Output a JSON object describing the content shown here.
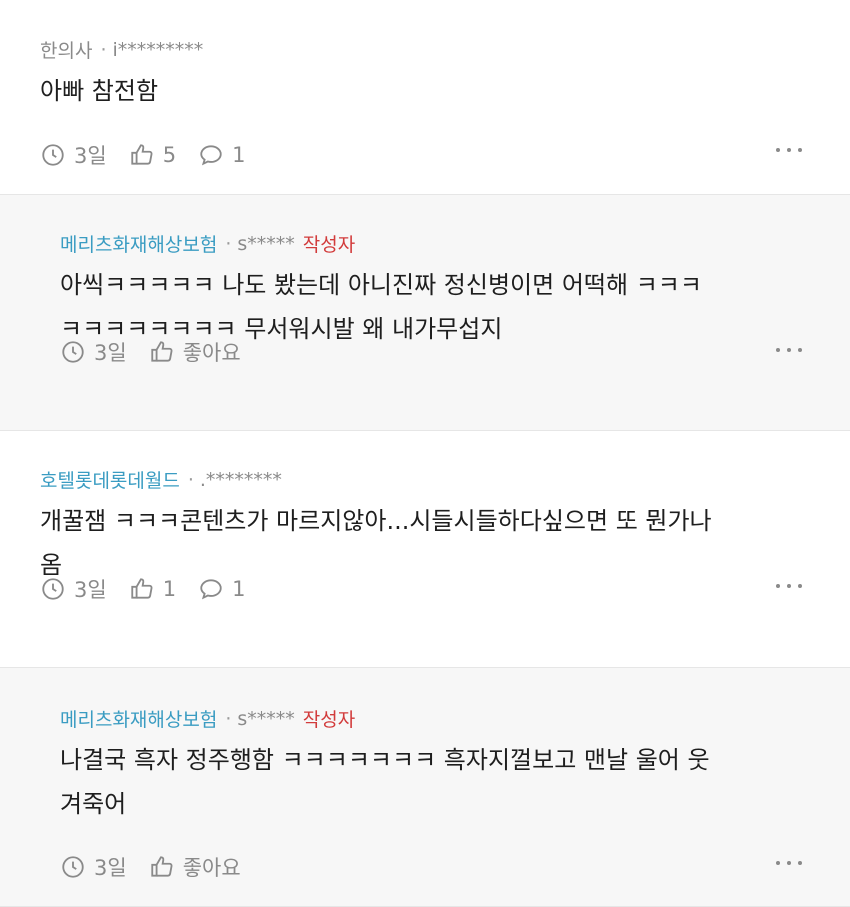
{
  "comments": [
    {
      "nickname": "한의사",
      "user": "i*********",
      "text_lines": [
        "아빠 참전함"
      ],
      "time": "3일",
      "likes": "5",
      "replies": "1"
    },
    {
      "nickname": "메리츠화재해상보험",
      "user": "s*****",
      "author_tag": "작성자",
      "text_lines": [
        "아씩ㅋㅋㅋㅋㅋ 나도 봤는데 아니진짜 정신병이면 어떡해 ㅋㅋㅋ",
        "ㅋㅋㅋㅋㅋㅋㅋㅋ 무서워시발 왜 내가무섭지"
      ],
      "time": "3일",
      "likes": "좋아요"
    },
    {
      "nickname": "호텔롯데롯데월드",
      "user": ".********",
      "text_lines": [
        "개꿀잼 ㅋㅋㅋ콘텐츠가 마르지않아...시들시들하다싶으면 또 뭔가나",
        "옴"
      ],
      "time": "3일",
      "likes": "1",
      "replies": "1"
    },
    {
      "nickname": "메리츠화재해상보험",
      "user": "s*****",
      "author_tag": "작성자",
      "text_lines": [
        "나결국 흑자 정주행함 ㅋㅋㅋㅋㅋㅋㅋ 흑자지껄보고 맨날 울어 웃",
        "겨죽어"
      ],
      "time": "3일",
      "likes": "좋아요"
    }
  ],
  "icons": {
    "time": "clock-icon",
    "like": "thumbs-up-icon",
    "reply": "speech-bubble-icon",
    "more": "more-options-icon"
  },
  "colors": {
    "nickname_link": "#3a9cc2",
    "author_tag": "#d23b3b",
    "meta_text": "#8a8a8a",
    "reply_background": "#f7f7f7"
  }
}
